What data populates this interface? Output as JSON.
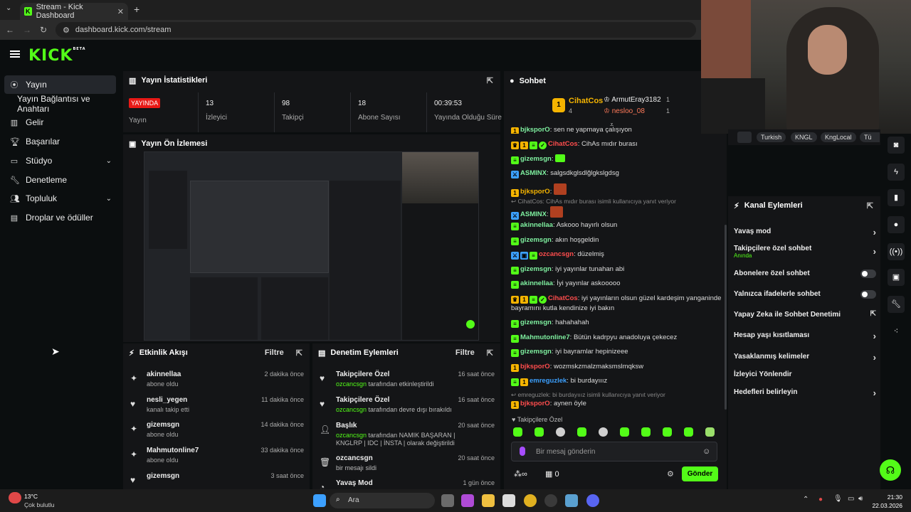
{
  "browser": {
    "tab_title": "Stream - Kick Dashboard",
    "url": "dashboard.kick.com/stream"
  },
  "brand": {
    "logo": "KICK",
    "logo_badge": "BETA",
    "accent": "#53fc18"
  },
  "sidebar": {
    "items": [
      {
        "label": "Yayın",
        "icon": "broadcast-icon"
      },
      {
        "label": "Yayın Bağlantısı ve Anahtarı",
        "icon": ""
      },
      {
        "label": "Gelir",
        "icon": "revenue-icon"
      },
      {
        "label": "Başarılar",
        "icon": "trophy-icon"
      },
      {
        "label": "Stüdyo",
        "icon": "studio-icon"
      },
      {
        "label": "Denetleme",
        "icon": "wrench-icon"
      },
      {
        "label": "Topluluk",
        "icon": "community-icon"
      },
      {
        "label": "Droplar ve ödüller",
        "icon": "gift-icon"
      }
    ]
  },
  "stats": {
    "title": "Yayın İstatistikleri",
    "live_badge": "YAYINDA",
    "live_label": "Yayın",
    "items": [
      {
        "value": "13",
        "label": "İzleyici"
      },
      {
        "value": "98",
        "label": "Takipçi"
      },
      {
        "value": "18",
        "label": "Abone Sayısı"
      },
      {
        "value": "00:39:53",
        "label": "Yayında Olduğu Süre"
      }
    ]
  },
  "preview": {
    "title": "Yayın Ön İzlemesi"
  },
  "activity": {
    "title": "Etkinlik Akışı",
    "filter": "Filtre",
    "items": [
      {
        "name": "akinnellaa",
        "sub": "abone oldu",
        "time": "2 dakika önce"
      },
      {
        "name": "nesli_yegen",
        "sub": "kanalı takip etti",
        "time": "11 dakika önce"
      },
      {
        "name": "gizemsgn",
        "sub": "abone oldu",
        "time": "14 dakika önce"
      },
      {
        "name": "Mahmutonline7",
        "sub": "abone oldu",
        "time": "33 dakika önce"
      },
      {
        "name": "gizemsgn",
        "sub": "",
        "time": "3 saat önce"
      }
    ]
  },
  "moderation": {
    "title": "Denetim Eylemleri",
    "filter": "Filtre",
    "items": [
      {
        "name": "Takipçilere Özel",
        "actor": "ozcancsgn",
        "rest": "tarafından etkinleştirildi",
        "time": "16 saat önce"
      },
      {
        "name": "Takipçilere Özel",
        "actor": "ozcancsgn",
        "rest": "tarafından devre dışı bırakıldı",
        "time": "16 saat önce"
      },
      {
        "name": "Başlık",
        "actor": "ozcancsgn",
        "rest": "tarafından NAMIK BAŞARAN | KNGLRP | IDC | İNSTA | olarak değiştirildi",
        "time": "20 saat önce"
      },
      {
        "name": "ozcancsgn",
        "actor": "",
        "rest": "bir mesajı sildi",
        "time": "20 saat önce"
      },
      {
        "name": "Yavaş Mod",
        "actor": "",
        "rest": "",
        "time": "1 gün önce"
      }
    ]
  },
  "chat": {
    "title": "Sohbet",
    "leaderboard": {
      "top": {
        "rank": "1",
        "name": "CihatCos",
        "count": "4"
      },
      "others": [
        {
          "name": "ArmutEray3182",
          "count": "1"
        },
        {
          "name": "nesloo_08",
          "count": "1"
        }
      ]
    },
    "messages": [
      {
        "user": "bjksporO",
        "text": "sen ne yapmaya çalışıyon"
      },
      {
        "user": "CihatCos",
        "text": "CihAs mıdır burası"
      },
      {
        "user": "gizemsgn",
        "text": ""
      },
      {
        "user": "ASMINX",
        "text": "salgsdkglsdlğlgkslgdsg"
      },
      {
        "user": "bjksporO",
        "text": ""
      },
      {
        "reply": "CihatCos: CihAs mıdır burası isimli kullanıcıya yanıt veriyor"
      },
      {
        "user": "ASMINX",
        "text": ""
      },
      {
        "user": "akinnellaa",
        "text": "Askooo hayırlı olsun"
      },
      {
        "user": "gizemsgn",
        "text": "akın hoşgeldin"
      },
      {
        "user": "ozcancsgn",
        "text": "düzelmiş"
      },
      {
        "user": "gizemsgn",
        "text": "iyi yayınlar tunahan abi"
      },
      {
        "user": "akinnellaa",
        "text": "İyi yayınlar askooooo"
      },
      {
        "user": "CihatCos",
        "text": "iyi yayınların olsun güzel kardeşim yanganinde bayramını kutla kendinize iyi bakın"
      },
      {
        "user": "gizemsgn",
        "text": "hahahahah"
      },
      {
        "user": "Mahmutonline7",
        "text": "Bütün kadrpyu anadoluya çekecez"
      },
      {
        "user": "gizemsgn",
        "text": "iyi bayramlar hepinizeee"
      },
      {
        "user": "bjksporO",
        "text": "wozmskzmalzmaksmslmqksw"
      },
      {
        "user": "emreguzlek",
        "text": "bi burdayııız"
      },
      {
        "reply": "emreguzlek: bi burdayııız isimli kullanıcıya yanıt veriyor"
      },
      {
        "user": "bjksporO",
        "text": "aynen öyle"
      }
    ],
    "mode_label": "Takipçilere Özel",
    "input_placeholder": "Bir mesaj gönderin",
    "points": "∞",
    "gift_count": "0",
    "send_label": "Gönder"
  },
  "stream_tags": [
    "Turkish",
    "KNGL",
    "KngLocal",
    "Tü"
  ],
  "channel_actions": {
    "title": "Kanal Eylemleri",
    "items": [
      {
        "label": "Yavaş mod",
        "type": "chevron"
      },
      {
        "label": "Takipçilere özel sohbet",
        "sub": "Anında",
        "type": "chevron"
      },
      {
        "label": "Abonelere özel sohbet",
        "type": "toggle"
      },
      {
        "label": "Yalnızca ifadelerle sohbet",
        "type": "toggle"
      },
      {
        "label": "Yapay Zeka ile Sohbet Denetimi",
        "type": "external"
      },
      {
        "label": "Hesap yaşı kısıtlaması",
        "type": "chevron"
      },
      {
        "label": "Yasaklanmış kelimeler",
        "type": "chevron"
      },
      {
        "label": "İzleyici Yönlendir",
        "type": "none"
      },
      {
        "label": "Hedefleri belirleyin",
        "type": "chevron"
      }
    ]
  },
  "taskbar": {
    "weather_temp": "13°C",
    "weather_desc": "Çok bulutlu",
    "search": "Ara",
    "time": "21:30",
    "date": "22.03.2026"
  }
}
